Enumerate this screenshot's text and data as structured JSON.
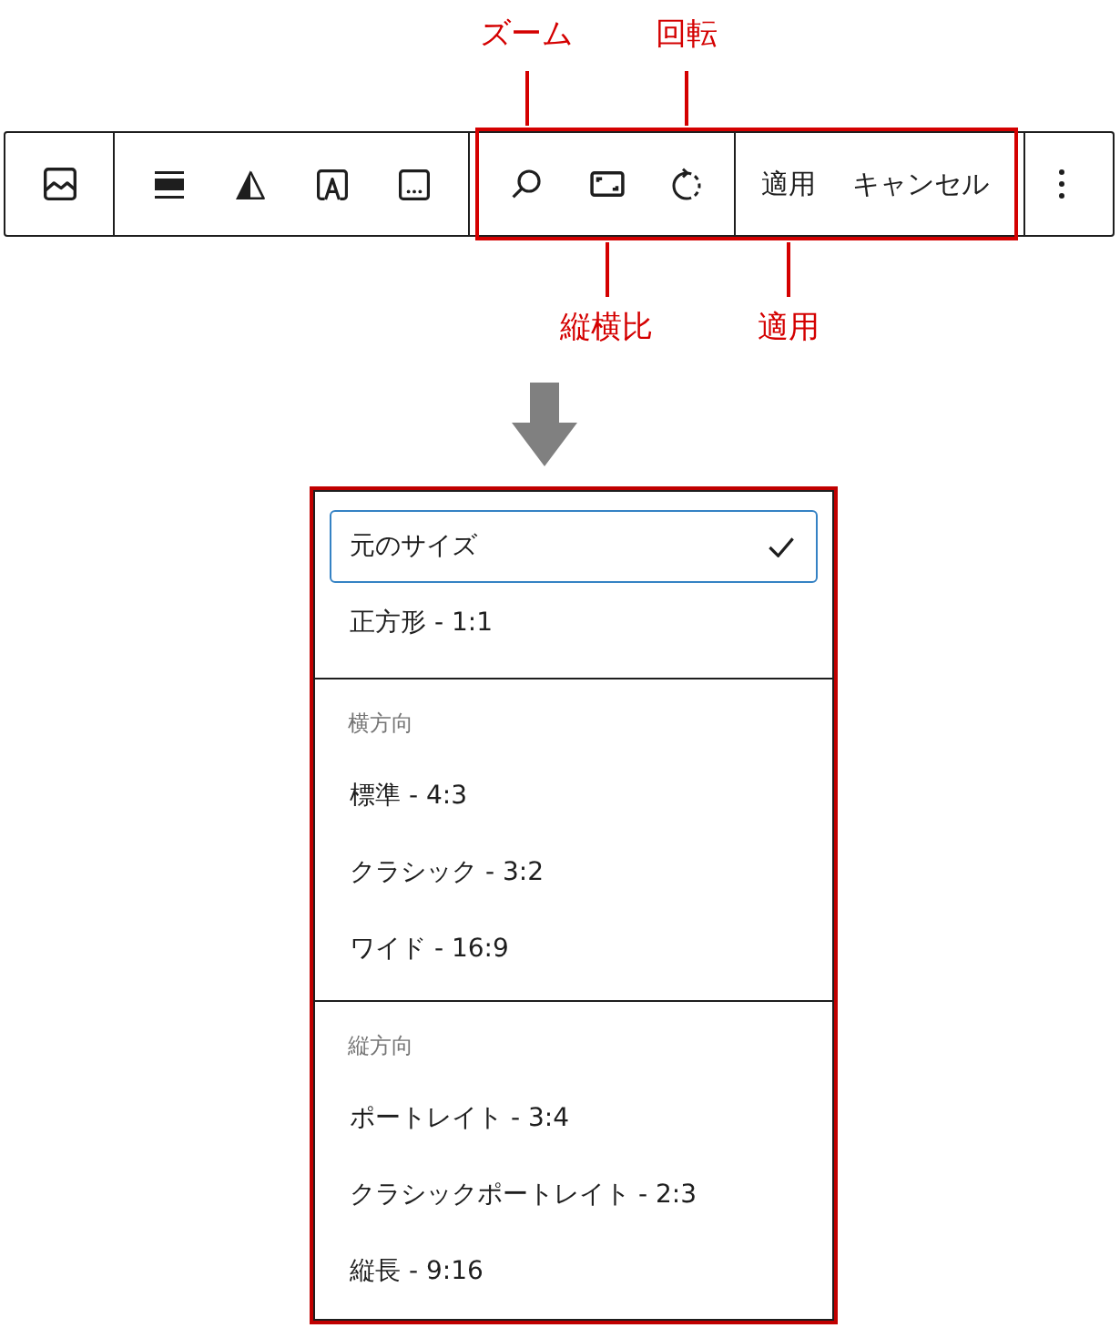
{
  "toolbar": {
    "groups": [
      {
        "highlighted": false,
        "items": [
          {
            "kind": "image"
          }
        ]
      },
      {
        "highlighted": false,
        "items": [
          {
            "kind": "align"
          },
          {
            "kind": "duotone"
          },
          {
            "kind": "overlay"
          },
          {
            "kind": "caption"
          }
        ]
      },
      {
        "highlighted": true,
        "items": [
          {
            "kind": "zoom",
            "callout_above": "ズーム"
          },
          {
            "kind": "aspect",
            "callout_below": "縦横比"
          },
          {
            "kind": "rotate",
            "callout_above": "回転"
          }
        ]
      },
      {
        "highlighted": true,
        "items": [
          {
            "kind": "text",
            "label": "適用",
            "callout_below": "適用"
          },
          {
            "kind": "text",
            "label": "キャンセル"
          }
        ]
      },
      {
        "highlighted": false,
        "items": [
          {
            "kind": "more"
          }
        ]
      }
    ]
  },
  "menu": {
    "highlighted": true,
    "sections": [
      {
        "items": [
          {
            "label": "元のサイズ",
            "selected": true
          },
          {
            "label": "正方形 - 1:1",
            "selected": false
          }
        ]
      },
      {
        "heading": "横方向",
        "items": [
          {
            "label": "標準 - 4:3",
            "selected": false
          },
          {
            "label": "クラシック - 3:2",
            "selected": false
          },
          {
            "label": "ワイド - 16:9",
            "selected": false
          }
        ]
      },
      {
        "heading": "縦方向",
        "items": [
          {
            "label": "ポートレイト - 3:4",
            "selected": false
          },
          {
            "label": "クラシックポートレイト - 2:3",
            "selected": false
          },
          {
            "label": "縦長 - 9:16",
            "selected": false
          }
        ]
      }
    ]
  }
}
